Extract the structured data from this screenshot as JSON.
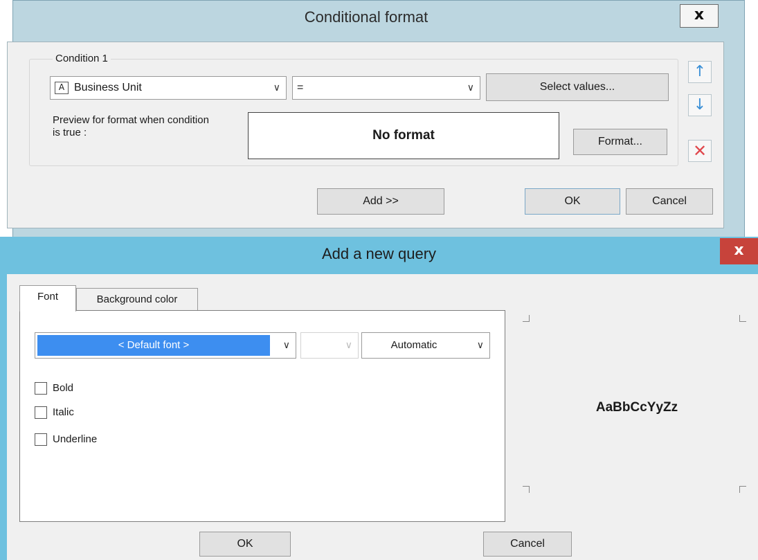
{
  "conditional_format": {
    "title": "Conditional format",
    "close_label": "x",
    "condition_label": "Condition 1",
    "field_combo": {
      "icon": "A",
      "value": "Business Unit"
    },
    "operator_combo": {
      "value": "="
    },
    "select_values_label": "Select values...",
    "preview_label": "Preview for format when condition is true :",
    "preview_text": "No format",
    "format_label": "Format...",
    "move_up_icon": "↑",
    "move_down_icon": "↓",
    "delete_icon": "✕",
    "add_label": "Add >>",
    "ok_label": "OK",
    "cancel_label": "Cancel",
    "colors": {
      "window": "#bcd6e0",
      "arrow": "#3a8fd6",
      "delete": "#e0474c"
    }
  },
  "add_query": {
    "title": "Add a new query",
    "close_label": "x",
    "tabs": [
      "Font",
      "Background color"
    ],
    "font_combo": {
      "value": "< Default font >"
    },
    "size_combo": {
      "value": ""
    },
    "color_combo": {
      "value": "Automatic"
    },
    "checkboxes": [
      {
        "label": "Bold",
        "checked": false
      },
      {
        "label": "Italic",
        "checked": false
      },
      {
        "label": "Underline",
        "checked": false
      }
    ],
    "sample_text": "AaBbCcYyZz",
    "ok_label": "OK",
    "cancel_label": "Cancel",
    "colors": {
      "titlebar": "#6ec1df",
      "close": "#c7433b",
      "selection": "#3d8ef0"
    }
  },
  "icons": {
    "chevron": "∨"
  }
}
